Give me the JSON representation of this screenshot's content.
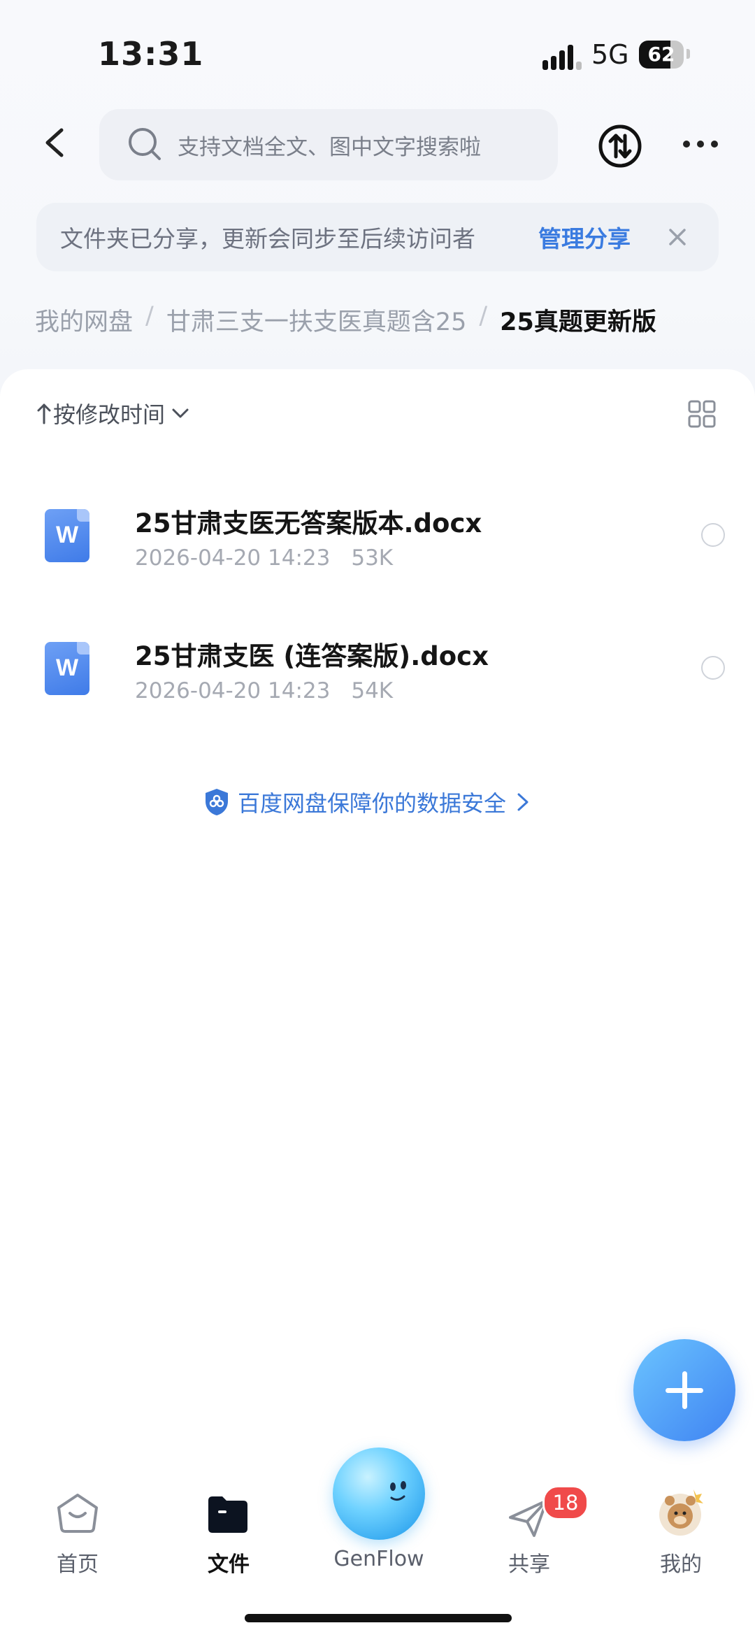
{
  "status_bar": {
    "time": "13:31",
    "network": "5G",
    "battery": "62"
  },
  "header": {
    "search_placeholder": "支持文档全文、图中文字搜索啦"
  },
  "banner": {
    "text": "文件夹已分享，更新会同步至后续访问者",
    "link": "管理分享"
  },
  "breadcrumb": {
    "items": [
      "我的网盘",
      "甘肃三支一扶支医真题含25",
      "25真题更新版"
    ],
    "separator": "/"
  },
  "toolbar": {
    "sort_label": "按修改时间"
  },
  "files": [
    {
      "name": "25甘肃支医无答案版本.docx",
      "date": "2026-04-20 14:23",
      "size": "53K",
      "type_glyph": "W"
    },
    {
      "name": "25甘肃支医 (连答案版).docx",
      "date": "2026-04-20 14:23",
      "size": "54K",
      "type_glyph": "W"
    }
  ],
  "security_notice": "百度网盘保障你的数据安全",
  "tabbar": {
    "home": "首页",
    "files": "文件",
    "genflow": "GenFlow",
    "share": "共享",
    "share_badge": "18",
    "me": "我的"
  },
  "colors": {
    "accent": "#3a7be0",
    "badge": "#f04a4a"
  }
}
